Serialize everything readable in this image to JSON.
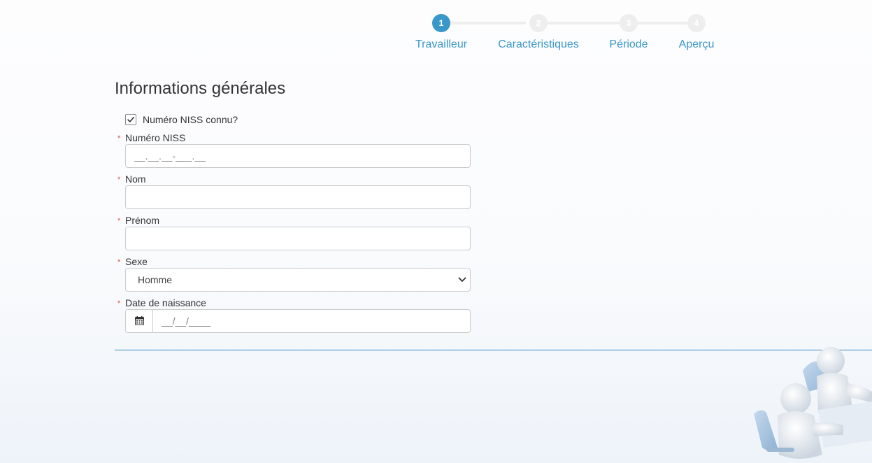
{
  "stepper": {
    "accent_color": "#3a97c9",
    "inactive_color": "#eeeeee",
    "steps": [
      {
        "number": "1",
        "label": "Travailleur",
        "active": true
      },
      {
        "number": "2",
        "label": "Caractéristiques",
        "active": false
      },
      {
        "number": "3",
        "label": "Période",
        "active": false
      },
      {
        "number": "4",
        "label": "Aperçu",
        "active": false
      }
    ]
  },
  "form": {
    "title": "Informations générales",
    "niss_known": {
      "label": "Numéro NISS connu?",
      "checked": true
    },
    "required_marker": "*",
    "fields": {
      "niss": {
        "label": "Numéro NISS",
        "value": "",
        "placeholder": "__.__.__-___.__"
      },
      "nom": {
        "label": "Nom",
        "value": "",
        "placeholder": ""
      },
      "prenom": {
        "label": "Prénom",
        "value": "",
        "placeholder": ""
      },
      "sexe": {
        "label": "Sexe",
        "selected": "Homme"
      },
      "date_naissance": {
        "label": "Date de naissance",
        "value": "",
        "placeholder": "__/__/____",
        "icon": "calendar-icon"
      }
    }
  },
  "decoration": {
    "illustration": "figures-at-desk-illustration"
  }
}
